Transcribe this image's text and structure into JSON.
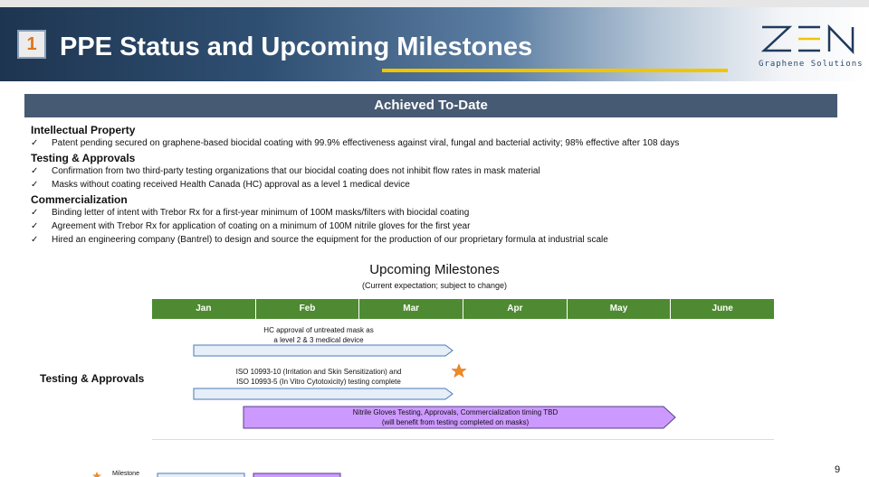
{
  "header": {
    "number": "1",
    "title": "PPE Status and Upcoming Milestones",
    "logo_text": "Z E N",
    "logo_subtitle": "Graphene Solutions"
  },
  "achieved": {
    "heading": "Achieved To-Date",
    "sections": [
      {
        "title": "Intellectual Property",
        "items": [
          "Patent pending secured on graphene-based biocidal coating with 99.9% effectiveness against viral, fungal and bacterial activity; 98% effective after 108 days"
        ]
      },
      {
        "title": "Testing & Approvals",
        "items": [
          "Confirmation from two third-party testing organizations that our biocidal coating does not inhibit flow rates in mask material",
          "Masks without coating received Health Canada (HC) approval as a level 1 medical device"
        ]
      },
      {
        "title": "Commercialization",
        "items": [
          "Binding letter of intent with Trebor Rx for a first-year minimum of 100M masks/filters with biocidal coating",
          "Agreement with Trebor Rx for application of coating on a minimum of 100M nitrile gloves for the first year",
          "Hired an engineering company (Bantrel) to design and source the equipment for the production of our proprietary formula at industrial scale"
        ]
      }
    ]
  },
  "milestones": {
    "title": "Upcoming Milestones",
    "subtitle": "(Current expectation; subject to change)",
    "months": [
      "Jan",
      "Feb",
      "Mar",
      "Apr",
      "May",
      "June"
    ],
    "row_label": "Testing & Approvals",
    "task1_caption_line1": "HC approval of untreated mask as",
    "task1_caption_line2": "a level 2 & 3 medical device",
    "task2_caption_line1": "ISO 10993-10 (Irritation and Skin Sensitization) and",
    "task2_caption_line2": "ISO 10993-5 (In Vitro Cytotoxicity) testing complete",
    "task3_line1": "Nitrile Gloves Testing, Approvals, Commercialization timing TBD",
    "task3_line2": "(will benefit from testing completed on masks)",
    "legend_label": "Milestone"
  },
  "page_number": "9",
  "colors": {
    "header_dark": "#1e3550",
    "gold_accent": "#f2c400",
    "achieved_bar": "#475a73",
    "month_green": "#4e8a31",
    "task_blue_fill": "#e6eef8",
    "task_blue_stroke": "#4a79b8",
    "task_purple_fill": "#cc99ff",
    "task_purple_stroke": "#5a3e8c",
    "milestone_star": "#f08a24"
  }
}
